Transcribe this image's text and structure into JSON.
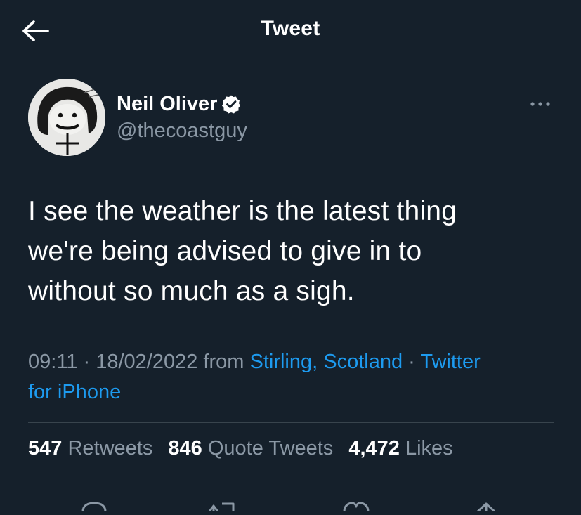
{
  "header": {
    "title": "Tweet",
    "back_icon": "arrow-left-icon"
  },
  "author": {
    "name": "Neil Oliver",
    "handle": "@thecoastguy",
    "verified_icon": "verified-badge-icon"
  },
  "tweet": {
    "lines": [
      "I see the weather is the latest thing",
      "we're being advised to give in to",
      "without so much as a sigh."
    ]
  },
  "meta": {
    "time": "09:11",
    "separator": " · ",
    "date": "18/02/2022",
    "from_label": " from ",
    "location": "Stirling, Scotland",
    "client_line1": "Twitter",
    "client_line2": "for iPhone"
  },
  "stats": {
    "retweets_count": "547",
    "retweets_label": "Retweets",
    "quotes_count": "846",
    "quotes_label": "Quote Tweets",
    "likes_count": "4,472",
    "likes_label": "Likes"
  },
  "actions": [
    {
      "icon": "reply-icon"
    },
    {
      "icon": "retweet-icon"
    },
    {
      "icon": "like-icon"
    },
    {
      "icon": "share-icon"
    }
  ],
  "colors": {
    "background": "#15202b",
    "text": "#ffffff",
    "secondary": "#8b98a5",
    "link": "#1d9bf0",
    "divider": "#38444d"
  }
}
